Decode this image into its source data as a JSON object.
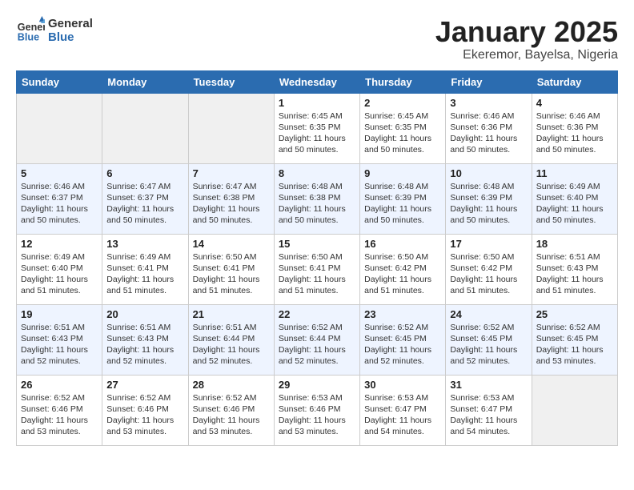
{
  "header": {
    "logo_line1": "General",
    "logo_line2": "Blue",
    "title": "January 2025",
    "subtitle": "Ekeremor, Bayelsa, Nigeria"
  },
  "weekdays": [
    "Sunday",
    "Monday",
    "Tuesday",
    "Wednesday",
    "Thursday",
    "Friday",
    "Saturday"
  ],
  "weeks": [
    [
      {
        "day": "",
        "empty": true
      },
      {
        "day": "",
        "empty": true
      },
      {
        "day": "",
        "empty": true
      },
      {
        "day": "1",
        "sunrise": "Sunrise: 6:45 AM",
        "sunset": "Sunset: 6:35 PM",
        "daylight": "Daylight: 11 hours and 50 minutes."
      },
      {
        "day": "2",
        "sunrise": "Sunrise: 6:45 AM",
        "sunset": "Sunset: 6:35 PM",
        "daylight": "Daylight: 11 hours and 50 minutes."
      },
      {
        "day": "3",
        "sunrise": "Sunrise: 6:46 AM",
        "sunset": "Sunset: 6:36 PM",
        "daylight": "Daylight: 11 hours and 50 minutes."
      },
      {
        "day": "4",
        "sunrise": "Sunrise: 6:46 AM",
        "sunset": "Sunset: 6:36 PM",
        "daylight": "Daylight: 11 hours and 50 minutes."
      }
    ],
    [
      {
        "day": "5",
        "sunrise": "Sunrise: 6:46 AM",
        "sunset": "Sunset: 6:37 PM",
        "daylight": "Daylight: 11 hours and 50 minutes."
      },
      {
        "day": "6",
        "sunrise": "Sunrise: 6:47 AM",
        "sunset": "Sunset: 6:37 PM",
        "daylight": "Daylight: 11 hours and 50 minutes."
      },
      {
        "day": "7",
        "sunrise": "Sunrise: 6:47 AM",
        "sunset": "Sunset: 6:38 PM",
        "daylight": "Daylight: 11 hours and 50 minutes."
      },
      {
        "day": "8",
        "sunrise": "Sunrise: 6:48 AM",
        "sunset": "Sunset: 6:38 PM",
        "daylight": "Daylight: 11 hours and 50 minutes."
      },
      {
        "day": "9",
        "sunrise": "Sunrise: 6:48 AM",
        "sunset": "Sunset: 6:39 PM",
        "daylight": "Daylight: 11 hours and 50 minutes."
      },
      {
        "day": "10",
        "sunrise": "Sunrise: 6:48 AM",
        "sunset": "Sunset: 6:39 PM",
        "daylight": "Daylight: 11 hours and 50 minutes."
      },
      {
        "day": "11",
        "sunrise": "Sunrise: 6:49 AM",
        "sunset": "Sunset: 6:40 PM",
        "daylight": "Daylight: 11 hours and 50 minutes."
      }
    ],
    [
      {
        "day": "12",
        "sunrise": "Sunrise: 6:49 AM",
        "sunset": "Sunset: 6:40 PM",
        "daylight": "Daylight: 11 hours and 51 minutes."
      },
      {
        "day": "13",
        "sunrise": "Sunrise: 6:49 AM",
        "sunset": "Sunset: 6:41 PM",
        "daylight": "Daylight: 11 hours and 51 minutes."
      },
      {
        "day": "14",
        "sunrise": "Sunrise: 6:50 AM",
        "sunset": "Sunset: 6:41 PM",
        "daylight": "Daylight: 11 hours and 51 minutes."
      },
      {
        "day": "15",
        "sunrise": "Sunrise: 6:50 AM",
        "sunset": "Sunset: 6:41 PM",
        "daylight": "Daylight: 11 hours and 51 minutes."
      },
      {
        "day": "16",
        "sunrise": "Sunrise: 6:50 AM",
        "sunset": "Sunset: 6:42 PM",
        "daylight": "Daylight: 11 hours and 51 minutes."
      },
      {
        "day": "17",
        "sunrise": "Sunrise: 6:50 AM",
        "sunset": "Sunset: 6:42 PM",
        "daylight": "Daylight: 11 hours and 51 minutes."
      },
      {
        "day": "18",
        "sunrise": "Sunrise: 6:51 AM",
        "sunset": "Sunset: 6:43 PM",
        "daylight": "Daylight: 11 hours and 51 minutes."
      }
    ],
    [
      {
        "day": "19",
        "sunrise": "Sunrise: 6:51 AM",
        "sunset": "Sunset: 6:43 PM",
        "daylight": "Daylight: 11 hours and 52 minutes."
      },
      {
        "day": "20",
        "sunrise": "Sunrise: 6:51 AM",
        "sunset": "Sunset: 6:43 PM",
        "daylight": "Daylight: 11 hours and 52 minutes."
      },
      {
        "day": "21",
        "sunrise": "Sunrise: 6:51 AM",
        "sunset": "Sunset: 6:44 PM",
        "daylight": "Daylight: 11 hours and 52 minutes."
      },
      {
        "day": "22",
        "sunrise": "Sunrise: 6:52 AM",
        "sunset": "Sunset: 6:44 PM",
        "daylight": "Daylight: 11 hours and 52 minutes."
      },
      {
        "day": "23",
        "sunrise": "Sunrise: 6:52 AM",
        "sunset": "Sunset: 6:45 PM",
        "daylight": "Daylight: 11 hours and 52 minutes."
      },
      {
        "day": "24",
        "sunrise": "Sunrise: 6:52 AM",
        "sunset": "Sunset: 6:45 PM",
        "daylight": "Daylight: 11 hours and 52 minutes."
      },
      {
        "day": "25",
        "sunrise": "Sunrise: 6:52 AM",
        "sunset": "Sunset: 6:45 PM",
        "daylight": "Daylight: 11 hours and 53 minutes."
      }
    ],
    [
      {
        "day": "26",
        "sunrise": "Sunrise: 6:52 AM",
        "sunset": "Sunset: 6:46 PM",
        "daylight": "Daylight: 11 hours and 53 minutes."
      },
      {
        "day": "27",
        "sunrise": "Sunrise: 6:52 AM",
        "sunset": "Sunset: 6:46 PM",
        "daylight": "Daylight: 11 hours and 53 minutes."
      },
      {
        "day": "28",
        "sunrise": "Sunrise: 6:52 AM",
        "sunset": "Sunset: 6:46 PM",
        "daylight": "Daylight: 11 hours and 53 minutes."
      },
      {
        "day": "29",
        "sunrise": "Sunrise: 6:53 AM",
        "sunset": "Sunset: 6:46 PM",
        "daylight": "Daylight: 11 hours and 53 minutes."
      },
      {
        "day": "30",
        "sunrise": "Sunrise: 6:53 AM",
        "sunset": "Sunset: 6:47 PM",
        "daylight": "Daylight: 11 hours and 54 minutes."
      },
      {
        "day": "31",
        "sunrise": "Sunrise: 6:53 AM",
        "sunset": "Sunset: 6:47 PM",
        "daylight": "Daylight: 11 hours and 54 minutes."
      },
      {
        "day": "",
        "empty": true
      }
    ]
  ]
}
